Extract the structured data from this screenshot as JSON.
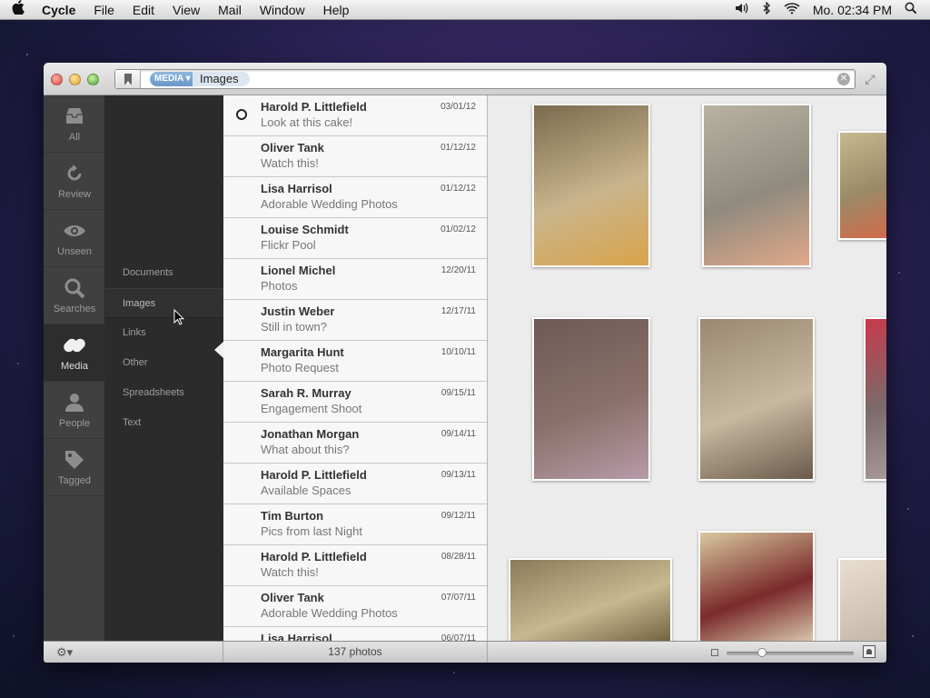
{
  "menubar": {
    "app_name": "Cycle",
    "items": [
      "File",
      "Edit",
      "View",
      "Mail",
      "Window",
      "Help"
    ],
    "clock": "Mo. 02:34 PM"
  },
  "search": {
    "media_token": "MEDIA",
    "images_token": "Images"
  },
  "nav": [
    {
      "label": "All",
      "icon": "inbox-icon"
    },
    {
      "label": "Review",
      "icon": "refresh-icon"
    },
    {
      "label": "Unseen",
      "icon": "eye-icon"
    },
    {
      "label": "Searches",
      "icon": "search-icon"
    },
    {
      "label": "Media",
      "icon": "link-icon"
    },
    {
      "label": "People",
      "icon": "person-icon"
    },
    {
      "label": "Tagged",
      "icon": "tag-icon"
    }
  ],
  "active_nav": "Media",
  "media_categories": [
    "Documents",
    "Images",
    "Links",
    "Other",
    "Spreadsheets",
    "Text"
  ],
  "selected_category": "Images",
  "messages": [
    {
      "sender": "Harold P. Littlefield",
      "subject": "Look at this cake!",
      "date": "03/01/12"
    },
    {
      "sender": "Oliver Tank",
      "subject": "Watch this!",
      "date": "01/12/12"
    },
    {
      "sender": "Lisa Harrisol",
      "subject": "Adorable Wedding Photos",
      "date": "01/12/12"
    },
    {
      "sender": "Louise Schmidt",
      "subject": "Flickr Pool",
      "date": "01/02/12"
    },
    {
      "sender": "Lionel Michel",
      "subject": "Photos",
      "date": "12/20/11"
    },
    {
      "sender": "Justin Weber",
      "subject": "Still in town?",
      "date": "12/17/11"
    },
    {
      "sender": "Margarita Hunt",
      "subject": "Photo Request",
      "date": "10/10/11"
    },
    {
      "sender": "Sarah R. Murray",
      "subject": "Engagement Shoot",
      "date": "09/15/11"
    },
    {
      "sender": "Jonathan Morgan",
      "subject": "What about this?",
      "date": "09/14/11"
    },
    {
      "sender": "Harold P. Littlefield",
      "subject": "Available Spaces",
      "date": "09/13/11"
    },
    {
      "sender": "Tim Burton",
      "subject": "Pics from last Night",
      "date": "09/12/11"
    },
    {
      "sender": "Harold P. Littlefield",
      "subject": "Watch this!",
      "date": "08/28/11"
    },
    {
      "sender": "Oliver Tank",
      "subject": "Adorable Wedding Photos",
      "date": "07/07/11"
    },
    {
      "sender": "Lisa Harrisol",
      "subject": "",
      "date": "06/07/11"
    }
  ],
  "status": {
    "count": "137 photos"
  },
  "photos": [
    {
      "name": "couple-with-flowers",
      "colors": [
        "#7a6a4f",
        "#c9b58c",
        "#d9a34a"
      ]
    },
    {
      "name": "legs-and-balloons",
      "colors": [
        "#b9b2a2",
        "#8f8b7e",
        "#e0a88a"
      ]
    },
    {
      "name": "balloons-edge",
      "colors": [
        "#c8b890",
        "#9a8a66",
        "#d46a4a"
      ]
    },
    {
      "name": "lapel-pin",
      "colors": [
        "#6e5a56",
        "#8a706a",
        "#b79aa8"
      ]
    },
    {
      "name": "couple-with-sodas",
      "colors": [
        "#9a8870",
        "#c8b8a0",
        "#6a5a4a"
      ]
    },
    {
      "name": "red-edge",
      "colors": [
        "#c83a4a",
        "#7a6a6a",
        "#a89898"
      ]
    },
    {
      "name": "house-and-balloons",
      "colors": [
        "#8a7a5a",
        "#c8b890",
        "#6a5a3a"
      ]
    },
    {
      "name": "soda-bottles",
      "colors": [
        "#d8c8a0",
        "#7a2a2a",
        "#e0d4b8"
      ]
    },
    {
      "name": "pale-edge",
      "colors": [
        "#e8ded0",
        "#d4c8b8",
        "#c0b4a4"
      ]
    }
  ]
}
